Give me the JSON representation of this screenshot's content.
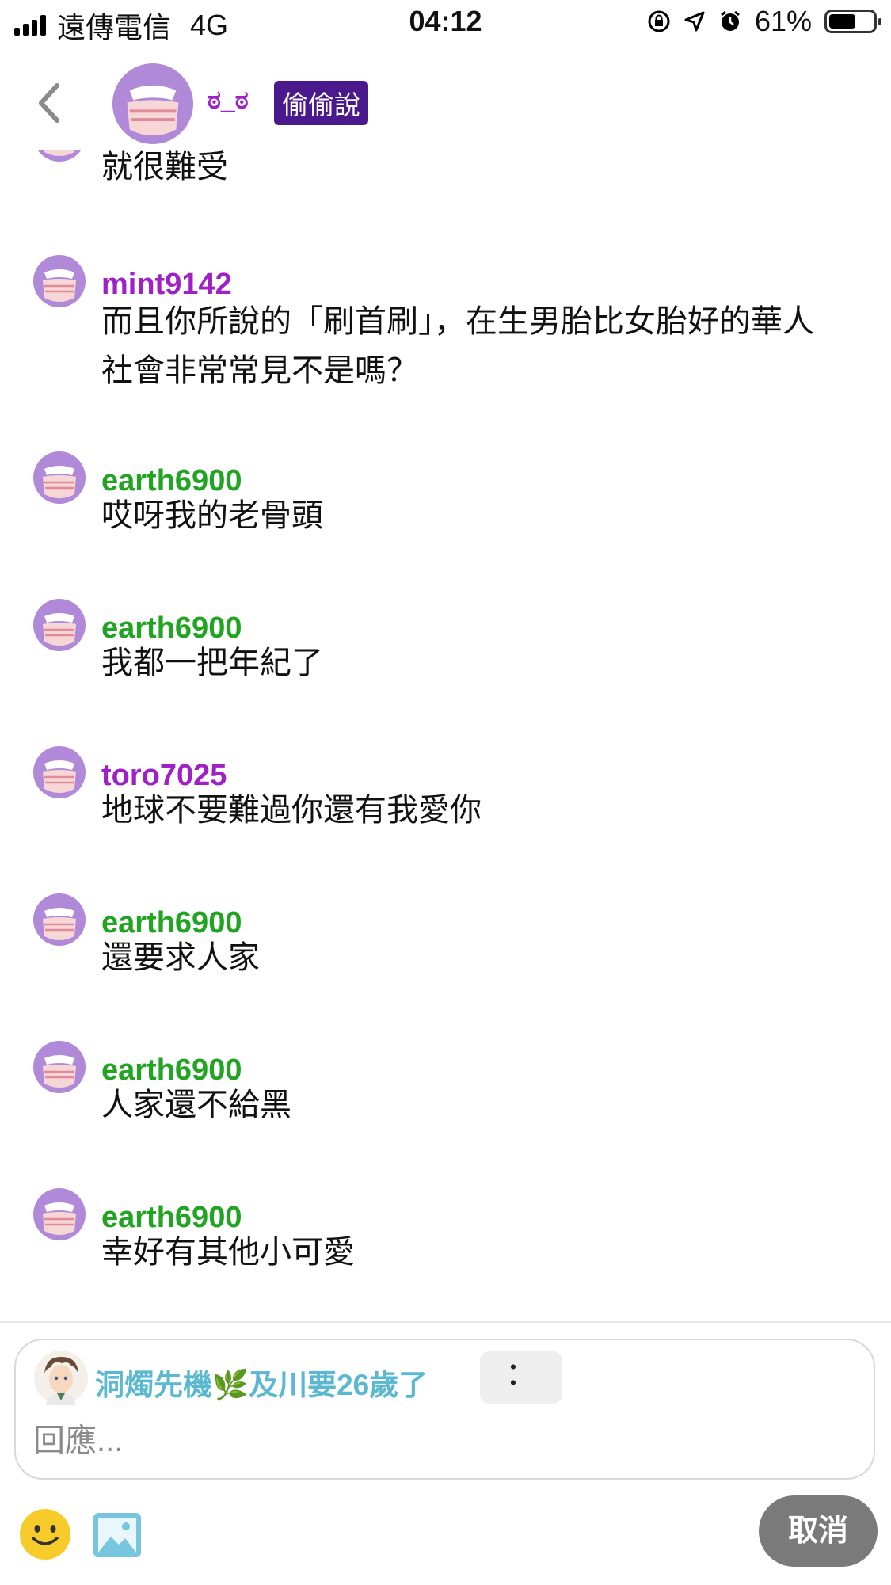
{
  "status_bar": {
    "carrier": "遠傳電信",
    "network": "4G",
    "time": "04:12",
    "battery": "61%",
    "battery_level": 0.61
  },
  "header": {
    "name": "ಠ_ಠ",
    "badge": "偷偷說"
  },
  "colors": {
    "purple_name": "#a020c8",
    "green_name": "#21a421",
    "badge_bg": "#4a1a8c",
    "reply_name": "#5ab8d0"
  },
  "messages": [
    {
      "user": "",
      "text": "就很難受"
    },
    {
      "user": "mint9142",
      "text": "而且你所說的「刷首刷」，在生男胎比女胎好的華人社會非常常見不是嗎？"
    },
    {
      "user": "earth6900",
      "text": "哎呀我的老骨頭"
    },
    {
      "user": "earth6900",
      "text": "我都一把年紀了"
    },
    {
      "user": "toro7025",
      "text": "地球不要難過你還有我愛你"
    },
    {
      "user": "earth6900",
      "text": "還要求人家"
    },
    {
      "user": "earth6900",
      "text": "人家還不給黑"
    },
    {
      "user": "earth6900",
      "text": "幸好有其他小可愛"
    }
  ],
  "reply": {
    "to_name": "洞燭先機🌿及川要26歲了",
    "more_label": "：",
    "placeholder": "回應..."
  },
  "actions": {
    "cancel_label": "取消"
  },
  "icons": [
    "back-arrow-icon",
    "masked-avatar-icon",
    "smiley-emoji-icon",
    "image-picker-icon",
    "signal-icon",
    "rotation-lock-icon",
    "location-icon",
    "alarm-icon",
    "battery-icon"
  ]
}
